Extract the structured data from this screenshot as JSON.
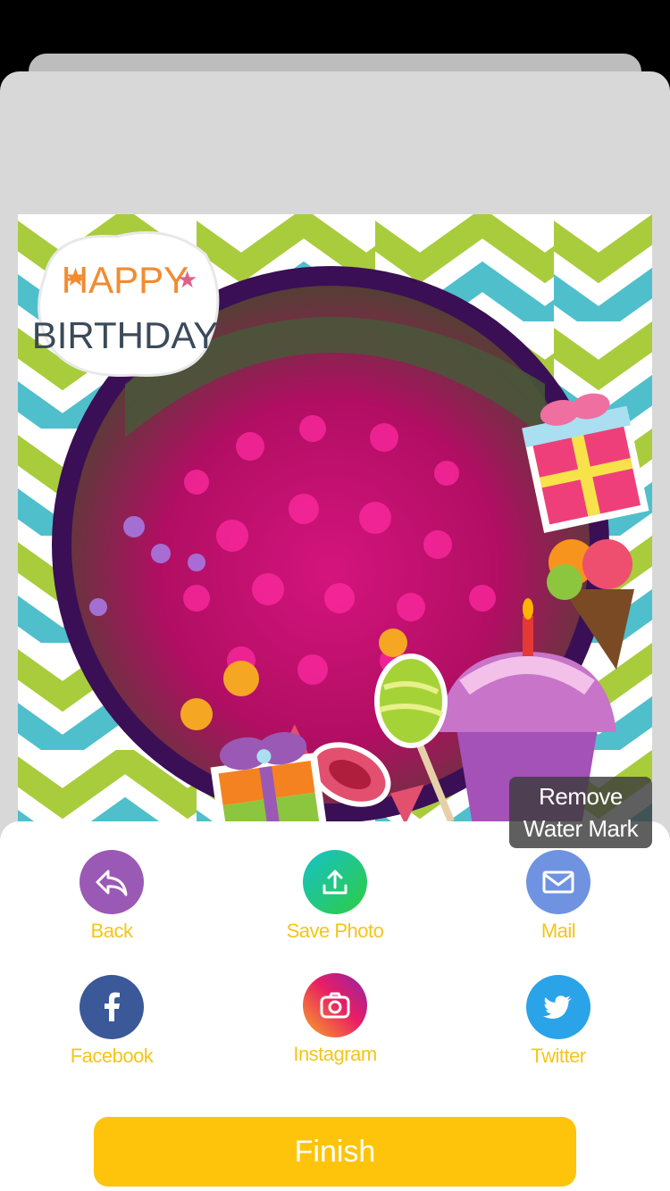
{
  "watermark": {
    "line1": "Remove",
    "line2": "Water Mark"
  },
  "sticker_text": {
    "line1": "HAPPY",
    "line2": "BIRTHDAY"
  },
  "actions": [
    {
      "label": "Back",
      "icon": "reply-arrow-icon",
      "color": "#9b59b6"
    },
    {
      "label": "Save Photo",
      "icon": "upload-icon",
      "color": "#1abc9c"
    },
    {
      "label": "Mail",
      "icon": "envelope-icon",
      "color": "#6f93e0"
    },
    {
      "label": "Facebook",
      "icon": "facebook-icon",
      "color": "#3b5998"
    },
    {
      "label": "Instagram",
      "icon": "camera-icon",
      "color": "#e1306c"
    },
    {
      "label": "Twitter",
      "icon": "twitter-bird-icon",
      "color": "#2aa3e8"
    }
  ],
  "finish_label": "Finish",
  "colors": {
    "accent": "#fdc40b",
    "label": "#f5c518"
  }
}
